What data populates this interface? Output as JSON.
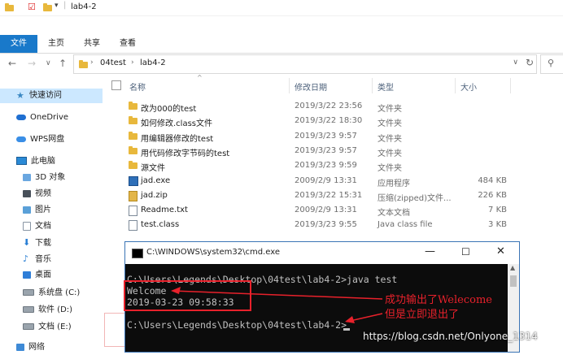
{
  "window": {
    "title": "lab4-2"
  },
  "ribbon": {
    "tabs": [
      "文件",
      "主页",
      "共享",
      "查看"
    ],
    "active_index": 0,
    "accent": "#1979ca"
  },
  "address": {
    "path": [
      "04test",
      "lab4-2"
    ]
  },
  "columns": {
    "name": "名称",
    "date": "修改日期",
    "type": "类型",
    "size": "大小"
  },
  "sidebar": {
    "items": [
      {
        "label": "快速访问",
        "icon": "star-icon",
        "selected": true
      },
      {
        "label": "OneDrive",
        "icon": "cloud-icon"
      },
      {
        "label": "WPS网盘",
        "icon": "cloud-icon"
      },
      {
        "label": "此电脑",
        "icon": "computer-icon"
      },
      {
        "label": "3D 对象",
        "icon": "3d-objects-icon"
      },
      {
        "label": "视频",
        "icon": "video-icon"
      },
      {
        "label": "图片",
        "icon": "pictures-icon"
      },
      {
        "label": "文档",
        "icon": "documents-icon"
      },
      {
        "label": "下载",
        "icon": "download-icon"
      },
      {
        "label": "音乐",
        "icon": "music-icon"
      },
      {
        "label": "桌面",
        "icon": "desktop-icon"
      },
      {
        "label": "系统盘 (C:)",
        "icon": "drive-icon"
      },
      {
        "label": "软件 (D:)",
        "icon": "drive-icon"
      },
      {
        "label": "文档 (E:)",
        "icon": "drive-icon"
      },
      {
        "label": "网络",
        "icon": "network-icon"
      }
    ]
  },
  "files": [
    {
      "name": "改为000的test",
      "date": "2019/3/22 23:56",
      "type": "文件夹",
      "size": "",
      "icon": "folder-icon"
    },
    {
      "name": "如何修改.class文件",
      "date": "2019/3/22 18:30",
      "type": "文件夹",
      "size": "",
      "icon": "folder-icon"
    },
    {
      "name": "用编辑器修改的test",
      "date": "2019/3/23 9:57",
      "type": "文件夹",
      "size": "",
      "icon": "folder-icon"
    },
    {
      "name": "用代码修改字节码的test",
      "date": "2019/3/23 9:57",
      "type": "文件夹",
      "size": "",
      "icon": "folder-icon"
    },
    {
      "name": "源文件",
      "date": "2019/3/23 9:59",
      "type": "文件夹",
      "size": "",
      "icon": "folder-icon"
    },
    {
      "name": "jad.exe",
      "date": "2009/2/9 13:31",
      "type": "应用程序",
      "size": "484 KB",
      "icon": "exe-icon"
    },
    {
      "name": "jad.zip",
      "date": "2019/3/22 15:31",
      "type": "压缩(zipped)文件...",
      "size": "226 KB",
      "icon": "zip-icon"
    },
    {
      "name": "Readme.txt",
      "date": "2009/2/9 13:31",
      "type": "文本文档",
      "size": "7 KB",
      "icon": "text-file-icon"
    },
    {
      "name": "test.class",
      "date": "2019/3/23 9:55",
      "type": "Java class file",
      "size": "3 KB",
      "icon": "file-icon"
    }
  ],
  "cmd": {
    "title": "C:\\WINDOWS\\system32\\cmd.exe",
    "lines": [
      "C:\\Users\\Legends\\Desktop\\04test\\lab4-2>java test",
      "Welcome",
      "2019-03-23 09:58:33",
      "",
      "C:\\Users\\Legends\\Desktop\\04test\\lab4-2>"
    ]
  },
  "annotations": {
    "line1": "成功输出了Welecome",
    "line2": "但是立即退出了",
    "color": "#e8212b"
  },
  "watermark": "https://blog.csdn.net/Onlyone_1314"
}
